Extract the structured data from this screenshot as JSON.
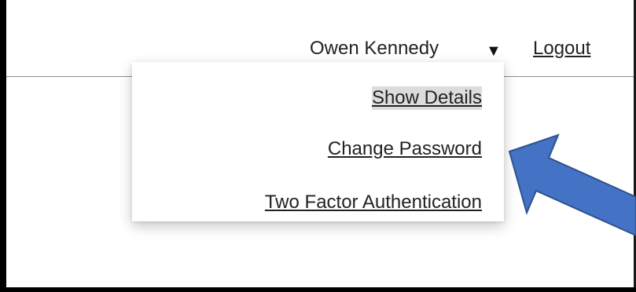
{
  "header": {
    "user_name": "Owen Kennedy",
    "caret_glyph": "▼",
    "logout_label": "Logout"
  },
  "dropdown": {
    "items": [
      {
        "label": "Show Details",
        "highlighted": true
      },
      {
        "label": "Change Password",
        "highlighted": false
      },
      {
        "label": "Two Factor Authentication",
        "highlighted": false
      }
    ]
  },
  "annotation": {
    "arrow_color": "#4472c4",
    "arrow_stroke": "#2f528f",
    "icon": "arrow-pointer-icon"
  }
}
